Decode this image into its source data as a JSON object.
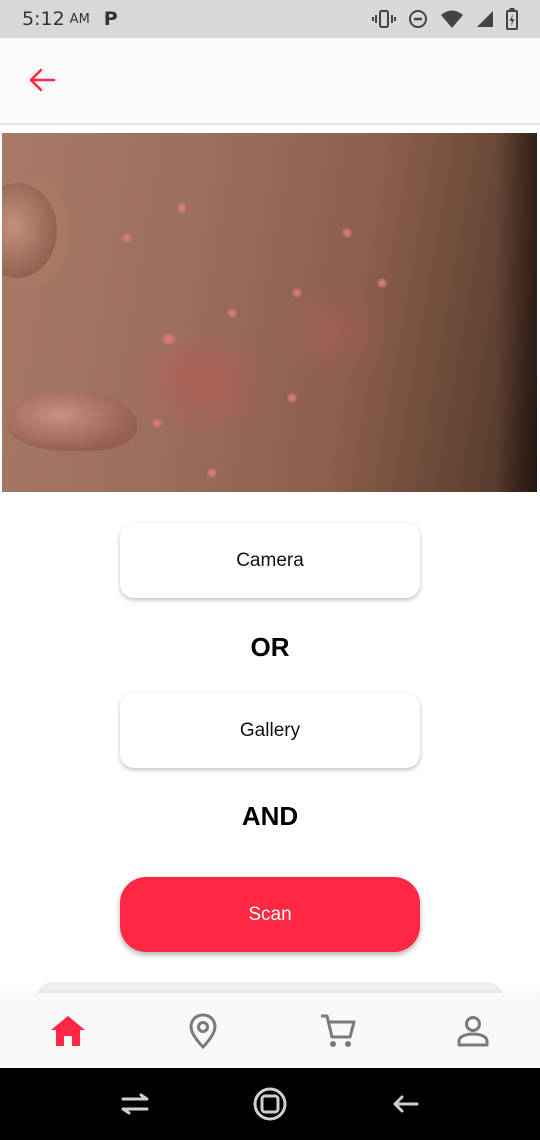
{
  "status_bar": {
    "time": "5:12",
    "ampm": "AM",
    "app_icon": "P",
    "icons": [
      "vibrate-icon",
      "do-not-disturb-icon",
      "wifi-icon",
      "signal-icon",
      "battery-icon"
    ]
  },
  "app_bar": {
    "back_icon": "arrow-left-icon"
  },
  "image": {
    "subject": "close-up photo of acne on a cheek"
  },
  "actions": {
    "camera_label": "Camera",
    "or_label": "OR",
    "gallery_label": "Gallery",
    "and_label": "AND",
    "scan_label": "Scan"
  },
  "bottom_nav": {
    "items": [
      {
        "icon": "home-icon",
        "active": true
      },
      {
        "icon": "location-pin-icon",
        "active": false
      },
      {
        "icon": "shopping-cart-icon",
        "active": false
      },
      {
        "icon": "profile-icon",
        "active": false
      }
    ]
  },
  "system_nav": [
    "recents-icon",
    "home-circle-icon",
    "back-icon"
  ],
  "colors": {
    "accent": "#ff2744",
    "nav_inactive": "#7a7a7a",
    "status_bar_bg": "#d8d8d8",
    "app_bar_bg": "#fafafa"
  }
}
